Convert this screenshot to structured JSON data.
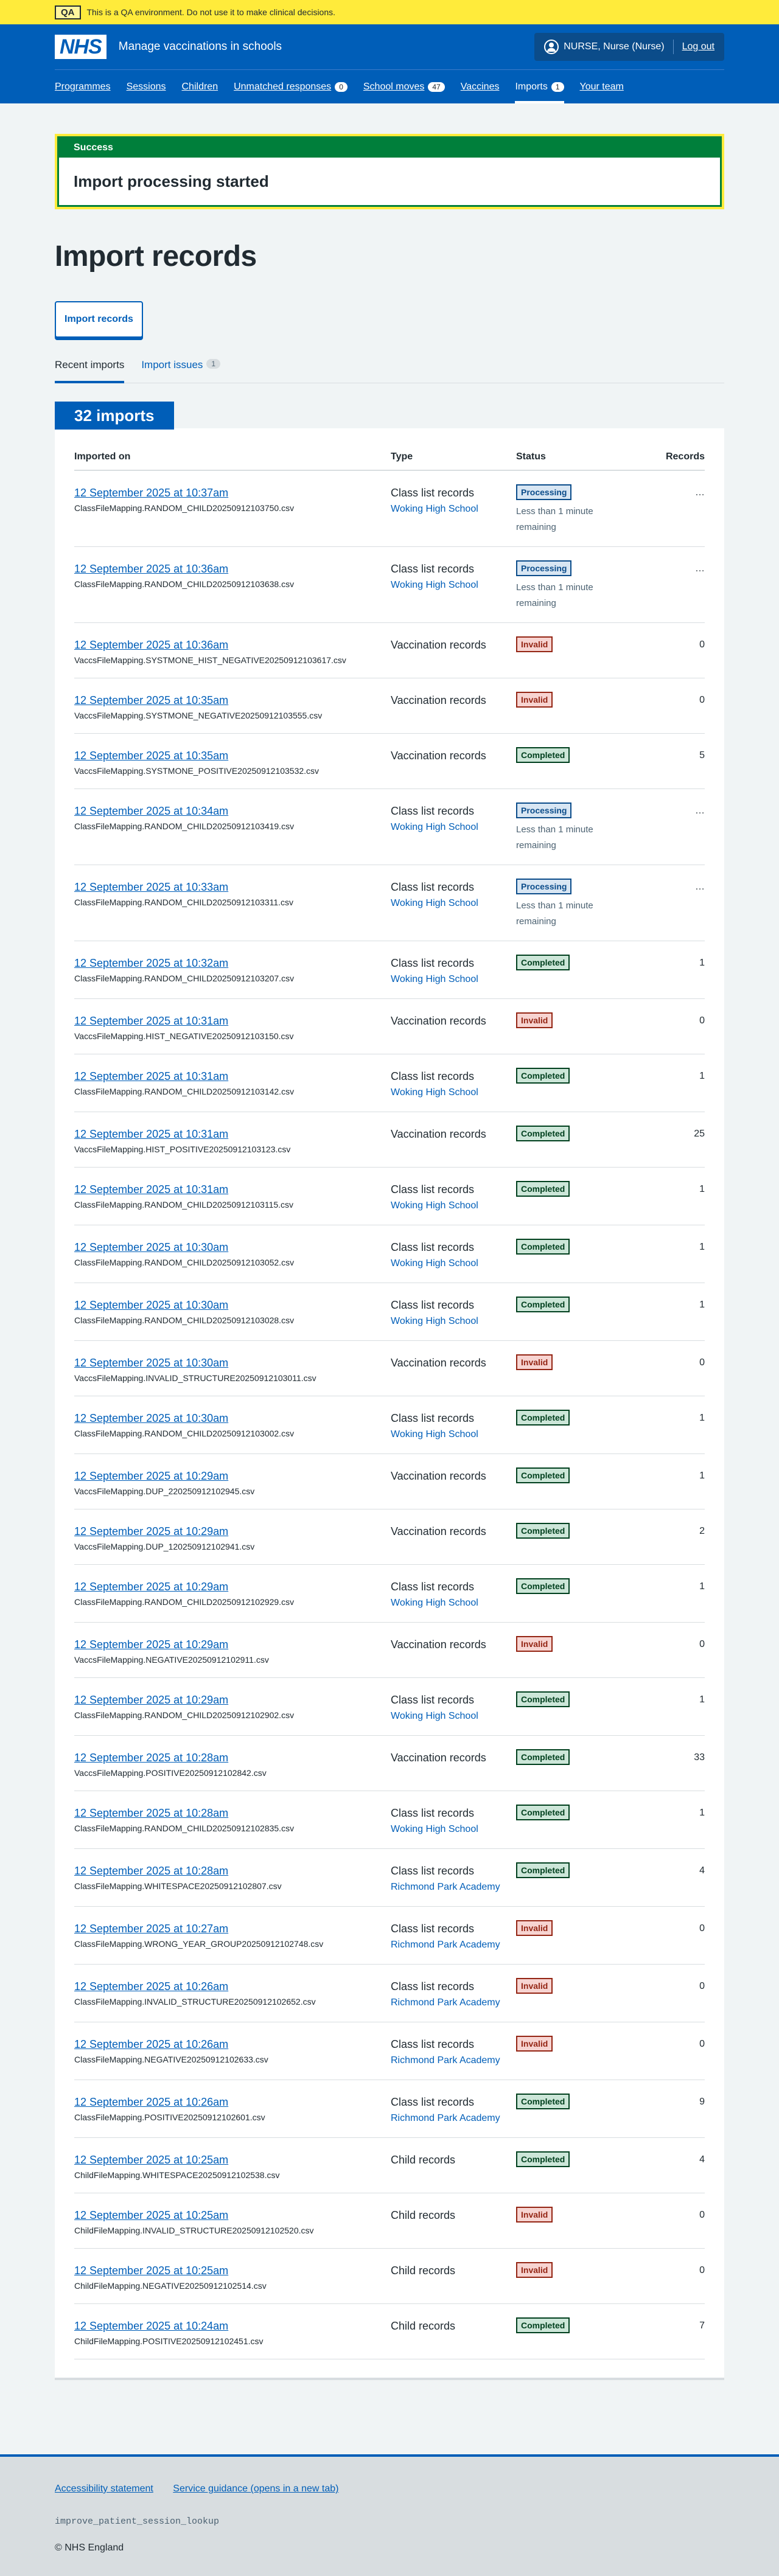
{
  "qa_banner": {
    "tag": "QA",
    "text": "This is a QA environment. Do not use it to make clinical decisions."
  },
  "header": {
    "logo": "NHS",
    "service_name": "Manage vaccinations in schools",
    "user": "NURSE, Nurse (Nurse)",
    "logout": "Log out",
    "nav": [
      {
        "label": "Programmes"
      },
      {
        "label": "Sessions"
      },
      {
        "label": "Children"
      },
      {
        "label": "Unmatched responses",
        "count": "0"
      },
      {
        "label": "School moves",
        "count": "47"
      },
      {
        "label": "Vaccines"
      },
      {
        "label": "Imports",
        "count": "1"
      },
      {
        "label": "Your team"
      }
    ]
  },
  "notice": {
    "heading": "Success",
    "body": "Import processing started"
  },
  "page_title": "Import records",
  "import_button": "Import records",
  "tabs": [
    {
      "label": "Recent imports"
    },
    {
      "label": "Import issues",
      "count": "1"
    }
  ],
  "card": {
    "heading": "32 imports",
    "columns": [
      "Imported on",
      "Type",
      "Status",
      "Records"
    ],
    "rows": [
      {
        "date": "12 September 2025 at 10:37am",
        "file": "ClassFileMapping.RANDOM_CHILD20250912103750.csv",
        "type": "Class list records",
        "school": "Woking High School",
        "status": "Processing",
        "note": "Less than 1 minute remaining",
        "records": "…"
      },
      {
        "date": "12 September 2025 at 10:36am",
        "file": "ClassFileMapping.RANDOM_CHILD20250912103638.csv",
        "type": "Class list records",
        "school": "Woking High School",
        "status": "Processing",
        "note": "Less than 1 minute remaining",
        "records": "…"
      },
      {
        "date": "12 September 2025 at 10:36am",
        "file": "VaccsFileMapping.SYSTMONE_HIST_NEGATIVE20250912103617.csv",
        "type": "Vaccination records",
        "school": "",
        "status": "Invalid",
        "note": "",
        "records": "0"
      },
      {
        "date": "12 September 2025 at 10:35am",
        "file": "VaccsFileMapping.SYSTMONE_NEGATIVE20250912103555.csv",
        "type": "Vaccination records",
        "school": "",
        "status": "Invalid",
        "note": "",
        "records": "0"
      },
      {
        "date": "12 September 2025 at 10:35am",
        "file": "VaccsFileMapping.SYSTMONE_POSITIVE20250912103532.csv",
        "type": "Vaccination records",
        "school": "",
        "status": "Completed",
        "note": "",
        "records": "5"
      },
      {
        "date": "12 September 2025 at 10:34am",
        "file": "ClassFileMapping.RANDOM_CHILD20250912103419.csv",
        "type": "Class list records",
        "school": "Woking High School",
        "status": "Processing",
        "note": "Less than 1 minute remaining",
        "records": "…"
      },
      {
        "date": "12 September 2025 at 10:33am",
        "file": "ClassFileMapping.RANDOM_CHILD20250912103311.csv",
        "type": "Class list records",
        "school": "Woking High School",
        "status": "Processing",
        "note": "Less than 1 minute remaining",
        "records": "…"
      },
      {
        "date": "12 September 2025 at 10:32am",
        "file": "ClassFileMapping.RANDOM_CHILD20250912103207.csv",
        "type": "Class list records",
        "school": "Woking High School",
        "status": "Completed",
        "note": "",
        "records": "1"
      },
      {
        "date": "12 September 2025 at 10:31am",
        "file": "VaccsFileMapping.HIST_NEGATIVE20250912103150.csv",
        "type": "Vaccination records",
        "school": "",
        "status": "Invalid",
        "note": "",
        "records": "0"
      },
      {
        "date": "12 September 2025 at 10:31am",
        "file": "ClassFileMapping.RANDOM_CHILD20250912103142.csv",
        "type": "Class list records",
        "school": "Woking High School",
        "status": "Completed",
        "note": "",
        "records": "1"
      },
      {
        "date": "12 September 2025 at 10:31am",
        "file": "VaccsFileMapping.HIST_POSITIVE20250912103123.csv",
        "type": "Vaccination records",
        "school": "",
        "status": "Completed",
        "note": "",
        "records": "25"
      },
      {
        "date": "12 September 2025 at 10:31am",
        "file": "ClassFileMapping.RANDOM_CHILD20250912103115.csv",
        "type": "Class list records",
        "school": "Woking High School",
        "status": "Completed",
        "note": "",
        "records": "1"
      },
      {
        "date": "12 September 2025 at 10:30am",
        "file": "ClassFileMapping.RANDOM_CHILD20250912103052.csv",
        "type": "Class list records",
        "school": "Woking High School",
        "status": "Completed",
        "note": "",
        "records": "1"
      },
      {
        "date": "12 September 2025 at 10:30am",
        "file": "ClassFileMapping.RANDOM_CHILD20250912103028.csv",
        "type": "Class list records",
        "school": "Woking High School",
        "status": "Completed",
        "note": "",
        "records": "1"
      },
      {
        "date": "12 September 2025 at 10:30am",
        "file": "VaccsFileMapping.INVALID_STRUCTURE20250912103011.csv",
        "type": "Vaccination records",
        "school": "",
        "status": "Invalid",
        "note": "",
        "records": "0"
      },
      {
        "date": "12 September 2025 at 10:30am",
        "file": "ClassFileMapping.RANDOM_CHILD20250912103002.csv",
        "type": "Class list records",
        "school": "Woking High School",
        "status": "Completed",
        "note": "",
        "records": "1"
      },
      {
        "date": "12 September 2025 at 10:29am",
        "file": "VaccsFileMapping.DUP_220250912102945.csv",
        "type": "Vaccination records",
        "school": "",
        "status": "Completed",
        "note": "",
        "records": "1"
      },
      {
        "date": "12 September 2025 at 10:29am",
        "file": "VaccsFileMapping.DUP_120250912102941.csv",
        "type": "Vaccination records",
        "school": "",
        "status": "Completed",
        "note": "",
        "records": "2"
      },
      {
        "date": "12 September 2025 at 10:29am",
        "file": "ClassFileMapping.RANDOM_CHILD20250912102929.csv",
        "type": "Class list records",
        "school": "Woking High School",
        "status": "Completed",
        "note": "",
        "records": "1"
      },
      {
        "date": "12 September 2025 at 10:29am",
        "file": "VaccsFileMapping.NEGATIVE20250912102911.csv",
        "type": "Vaccination records",
        "school": "",
        "status": "Invalid",
        "note": "",
        "records": "0"
      },
      {
        "date": "12 September 2025 at 10:29am",
        "file": "ClassFileMapping.RANDOM_CHILD20250912102902.csv",
        "type": "Class list records",
        "school": "Woking High School",
        "status": "Completed",
        "note": "",
        "records": "1"
      },
      {
        "date": "12 September 2025 at 10:28am",
        "file": "VaccsFileMapping.POSITIVE20250912102842.csv",
        "type": "Vaccination records",
        "school": "",
        "status": "Completed",
        "note": "",
        "records": "33"
      },
      {
        "date": "12 September 2025 at 10:28am",
        "file": "ClassFileMapping.RANDOM_CHILD20250912102835.csv",
        "type": "Class list records",
        "school": "Woking High School",
        "status": "Completed",
        "note": "",
        "records": "1"
      },
      {
        "date": "12 September 2025 at 10:28am",
        "file": "ClassFileMapping.WHITESPACE20250912102807.csv",
        "type": "Class list records",
        "school": "Richmond Park Academy",
        "status": "Completed",
        "note": "",
        "records": "4"
      },
      {
        "date": "12 September 2025 at 10:27am",
        "file": "ClassFileMapping.WRONG_YEAR_GROUP20250912102748.csv",
        "type": "Class list records",
        "school": "Richmond Park Academy",
        "status": "Invalid",
        "note": "",
        "records": "0"
      },
      {
        "date": "12 September 2025 at 10:26am",
        "file": "ClassFileMapping.INVALID_STRUCTURE20250912102652.csv",
        "type": "Class list records",
        "school": "Richmond Park Academy",
        "status": "Invalid",
        "note": "",
        "records": "0"
      },
      {
        "date": "12 September 2025 at 10:26am",
        "file": "ClassFileMapping.NEGATIVE20250912102633.csv",
        "type": "Class list records",
        "school": "Richmond Park Academy",
        "status": "Invalid",
        "note": "",
        "records": "0"
      },
      {
        "date": "12 September 2025 at 10:26am",
        "file": "ClassFileMapping.POSITIVE20250912102601.csv",
        "type": "Class list records",
        "school": "Richmond Park Academy",
        "status": "Completed",
        "note": "",
        "records": "9"
      },
      {
        "date": "12 September 2025 at 10:25am",
        "file": "ChildFileMapping.WHITESPACE20250912102538.csv",
        "type": "Child records",
        "school": "",
        "status": "Completed",
        "note": "",
        "records": "4"
      },
      {
        "date": "12 September 2025 at 10:25am",
        "file": "ChildFileMapping.INVALID_STRUCTURE20250912102520.csv",
        "type": "Child records",
        "school": "",
        "status": "Invalid",
        "note": "",
        "records": "0"
      },
      {
        "date": "12 September 2025 at 10:25am",
        "file": "ChildFileMapping.NEGATIVE20250912102514.csv",
        "type": "Child records",
        "school": "",
        "status": "Invalid",
        "note": "",
        "records": "0"
      },
      {
        "date": "12 September 2025 at 10:24am",
        "file": "ChildFileMapping.POSITIVE20250912102451.csv",
        "type": "Child records",
        "school": "",
        "status": "Completed",
        "note": "",
        "records": "7"
      }
    ]
  },
  "footer": {
    "links": [
      "Accessibility statement",
      "Service guidance (opens in a new tab)"
    ],
    "code": "improve_patient_session_lookup",
    "copyright": "© NHS England"
  },
  "colors": {
    "nhs_blue": "#005eb8",
    "qa_yellow": "#ffeb3b",
    "success_green": "#007f3b",
    "processing": "#0b4c8a",
    "invalid": "#942514",
    "completed": "#00401e"
  }
}
